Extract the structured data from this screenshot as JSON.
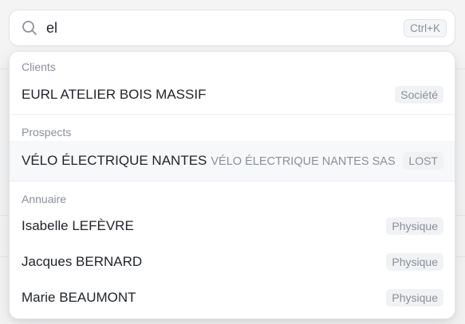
{
  "search": {
    "value": "el",
    "shortcut": "Ctrl+K"
  },
  "groups": [
    {
      "label": "Clients",
      "items": [
        {
          "title": "EURL ATELIER BOIS MASSIF",
          "subtitle": "",
          "badge": "Société"
        }
      ]
    },
    {
      "label": "Prospects",
      "items": [
        {
          "title": "VÉLO ÉLECTRIQUE NANTES",
          "subtitle": "VÉLO ÉLECTRIQUE NANTES SAS",
          "badge": "LOST"
        }
      ]
    },
    {
      "label": "Annuaire",
      "items": [
        {
          "title": "Isabelle LEFÈVRE",
          "subtitle": "",
          "badge": "Physique"
        },
        {
          "title": "Jacques BERNARD",
          "subtitle": "",
          "badge": "Physique"
        },
        {
          "title": "Marie BEAUMONT",
          "subtitle": "",
          "badge": "Physique"
        }
      ]
    }
  ],
  "colors": {
    "accent_text": "#1f2328",
    "muted_text": "#8a8f98",
    "badge_bg": "#f1f2f4",
    "highlight_bg": "#f7f8fa"
  }
}
